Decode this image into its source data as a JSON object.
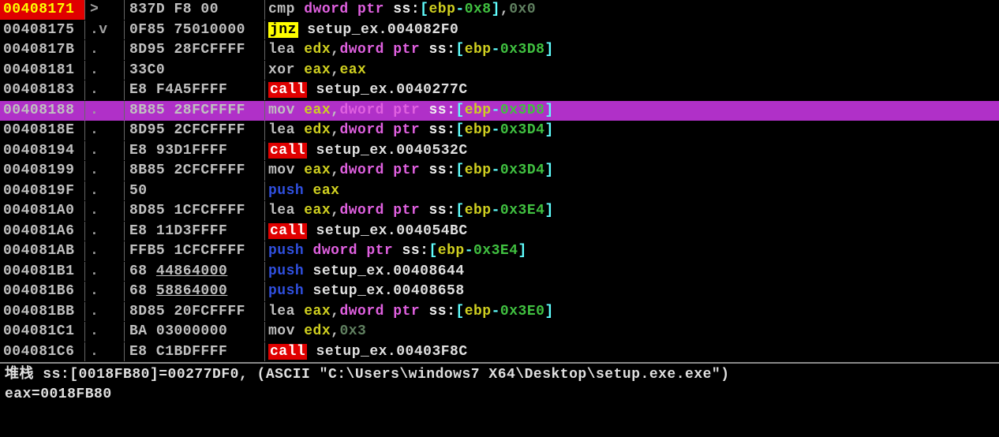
{
  "rows": [
    {
      "addr": "00408171",
      "addr_hl": true,
      "hint": ">",
      "bytes": "837D F8 00",
      "tok": [
        {
          "t": "cmp ",
          "c": "mn"
        },
        {
          "t": "dword ptr ",
          "c": "kw-ptr"
        },
        {
          "t": "ss",
          "c": "seg"
        },
        {
          "t": ":",
          "c": "seg"
        },
        {
          "t": "[",
          "c": "br"
        },
        {
          "t": "ebp",
          "c": "reg-y"
        },
        {
          "t": "-",
          "c": "br"
        },
        {
          "t": "0x8",
          "c": "num"
        },
        {
          "t": "]",
          "c": "br"
        },
        {
          "t": ",",
          "c": "comma"
        },
        {
          "t": "0x0",
          "c": "num-dim"
        }
      ]
    },
    {
      "addr": "00408175",
      "hint": ".v",
      "bytes": "0F85 75010000",
      "tok": [
        {
          "t": "jnz",
          "c": "mn-jmp-bg"
        },
        {
          "t": " setup_ex.004082F0",
          "c": "txt"
        }
      ]
    },
    {
      "addr": "0040817B",
      "hint": ".",
      "bytes": "8D95 28FCFFFF",
      "tok": [
        {
          "t": "lea ",
          "c": "mn"
        },
        {
          "t": "edx",
          "c": "reg-y"
        },
        {
          "t": ",",
          "c": "comma"
        },
        {
          "t": "dword ptr ",
          "c": "kw-ptr"
        },
        {
          "t": "ss",
          "c": "seg"
        },
        {
          "t": ":",
          "c": "seg"
        },
        {
          "t": "[",
          "c": "br"
        },
        {
          "t": "ebp",
          "c": "reg-y"
        },
        {
          "t": "-",
          "c": "br"
        },
        {
          "t": "0x3D8",
          "c": "num"
        },
        {
          "t": "]",
          "c": "br"
        }
      ]
    },
    {
      "addr": "00408181",
      "hint": ".",
      "bytes": "33C0",
      "tok": [
        {
          "t": "xor ",
          "c": "mn"
        },
        {
          "t": "eax",
          "c": "reg-y"
        },
        {
          "t": ",",
          "c": "comma"
        },
        {
          "t": "eax",
          "c": "reg-y"
        }
      ]
    },
    {
      "addr": "00408183",
      "hint": ".",
      "bytes": "E8 F4A5FFFF",
      "tok": [
        {
          "t": "call",
          "c": "mn-call-bg"
        },
        {
          "t": " setup_ex.0040277C",
          "c": "txt"
        }
      ]
    },
    {
      "addr": "00408188",
      "sel": true,
      "hint": ".",
      "bytes": "8B85 28FCFFFF",
      "tok": [
        {
          "t": "mov ",
          "c": "mn"
        },
        {
          "t": "eax",
          "c": "reg-y"
        },
        {
          "t": ",",
          "c": "comma"
        },
        {
          "t": "dword ptr ",
          "c": "kw-ptr"
        },
        {
          "t": "ss",
          "c": "seg"
        },
        {
          "t": ":",
          "c": "seg"
        },
        {
          "t": "[",
          "c": "br"
        },
        {
          "t": "ebp",
          "c": "reg-y"
        },
        {
          "t": "-",
          "c": "br"
        },
        {
          "t": "0x3D8",
          "c": "num"
        },
        {
          "t": "]",
          "c": "br"
        }
      ]
    },
    {
      "addr": "0040818E",
      "hint": ".",
      "bytes": "8D95 2CFCFFFF",
      "tok": [
        {
          "t": "lea ",
          "c": "mn"
        },
        {
          "t": "edx",
          "c": "reg-y"
        },
        {
          "t": ",",
          "c": "comma"
        },
        {
          "t": "dword ptr ",
          "c": "kw-ptr"
        },
        {
          "t": "ss",
          "c": "seg"
        },
        {
          "t": ":",
          "c": "seg"
        },
        {
          "t": "[",
          "c": "br"
        },
        {
          "t": "ebp",
          "c": "reg-y"
        },
        {
          "t": "-",
          "c": "br"
        },
        {
          "t": "0x3D4",
          "c": "num"
        },
        {
          "t": "]",
          "c": "br"
        }
      ]
    },
    {
      "addr": "00408194",
      "hint": ".",
      "bytes": "E8 93D1FFFF",
      "tok": [
        {
          "t": "call",
          "c": "mn-call-bg"
        },
        {
          "t": " setup_ex.0040532C",
          "c": "txt"
        }
      ]
    },
    {
      "addr": "00408199",
      "hint": ".",
      "bytes": "8B85 2CFCFFFF",
      "tok": [
        {
          "t": "mov ",
          "c": "mn"
        },
        {
          "t": "eax",
          "c": "reg-y"
        },
        {
          "t": ",",
          "c": "comma"
        },
        {
          "t": "dword ptr ",
          "c": "kw-ptr"
        },
        {
          "t": "ss",
          "c": "seg"
        },
        {
          "t": ":",
          "c": "seg"
        },
        {
          "t": "[",
          "c": "br"
        },
        {
          "t": "ebp",
          "c": "reg-y"
        },
        {
          "t": "-",
          "c": "br"
        },
        {
          "t": "0x3D4",
          "c": "num"
        },
        {
          "t": "]",
          "c": "br"
        }
      ]
    },
    {
      "addr": "0040819F",
      "hint": ".",
      "bytes": "50",
      "tok": [
        {
          "t": "push ",
          "c": "mn-push-dim"
        },
        {
          "t": "eax",
          "c": "reg-y"
        }
      ]
    },
    {
      "addr": "004081A0",
      "hint": ".",
      "bytes": "8D85 1CFCFFFF",
      "tok": [
        {
          "t": "lea ",
          "c": "mn"
        },
        {
          "t": "eax",
          "c": "reg-y"
        },
        {
          "t": ",",
          "c": "comma"
        },
        {
          "t": "dword ptr ",
          "c": "kw-ptr"
        },
        {
          "t": "ss",
          "c": "seg"
        },
        {
          "t": ":",
          "c": "seg"
        },
        {
          "t": "[",
          "c": "br"
        },
        {
          "t": "ebp",
          "c": "reg-y"
        },
        {
          "t": "-",
          "c": "br"
        },
        {
          "t": "0x3E4",
          "c": "num"
        },
        {
          "t": "]",
          "c": "br"
        }
      ]
    },
    {
      "addr": "004081A6",
      "hint": ".",
      "bytes": "E8 11D3FFFF",
      "tok": [
        {
          "t": "call",
          "c": "mn-call-bg"
        },
        {
          "t": " setup_ex.004054BC",
          "c": "txt"
        }
      ]
    },
    {
      "addr": "004081AB",
      "hint": ".",
      "bytes": "FFB5 1CFCFFFF",
      "tok": [
        {
          "t": "push ",
          "c": "mn-push-dim"
        },
        {
          "t": "dword ptr ",
          "c": "kw-ptr"
        },
        {
          "t": "ss",
          "c": "seg"
        },
        {
          "t": ":",
          "c": "seg"
        },
        {
          "t": "[",
          "c": "br"
        },
        {
          "t": "ebp",
          "c": "reg-y"
        },
        {
          "t": "-",
          "c": "br"
        },
        {
          "t": "0x3E4",
          "c": "num"
        },
        {
          "t": "]",
          "c": "br"
        }
      ]
    },
    {
      "addr": "004081B1",
      "hint": ".",
      "bytes": "68 ",
      "bytes2": "44864000",
      "tok": [
        {
          "t": "push ",
          "c": "mn-push-dim"
        },
        {
          "t": "setup_ex.00408644",
          "c": "txt"
        }
      ]
    },
    {
      "addr": "004081B6",
      "hint": ".",
      "bytes": "68 ",
      "bytes2": "58864000",
      "tok": [
        {
          "t": "push ",
          "c": "mn-push-dim"
        },
        {
          "t": "setup_ex.00408658",
          "c": "txt"
        }
      ]
    },
    {
      "addr": "004081BB",
      "hint": ".",
      "bytes": "8D85 20FCFFFF",
      "tok": [
        {
          "t": "lea ",
          "c": "mn"
        },
        {
          "t": "eax",
          "c": "reg-y"
        },
        {
          "t": ",",
          "c": "comma"
        },
        {
          "t": "dword ptr ",
          "c": "kw-ptr"
        },
        {
          "t": "ss",
          "c": "seg"
        },
        {
          "t": ":",
          "c": "seg"
        },
        {
          "t": "[",
          "c": "br"
        },
        {
          "t": "ebp",
          "c": "reg-y"
        },
        {
          "t": "-",
          "c": "br"
        },
        {
          "t": "0x3E0",
          "c": "num"
        },
        {
          "t": "]",
          "c": "br"
        }
      ]
    },
    {
      "addr": "004081C1",
      "hint": ".",
      "bytes": "BA 03000000",
      "tok": [
        {
          "t": "mov ",
          "c": "mn"
        },
        {
          "t": "edx",
          "c": "reg-y"
        },
        {
          "t": ",",
          "c": "comma"
        },
        {
          "t": "0x3",
          "c": "num-dim"
        }
      ]
    },
    {
      "addr": "004081C6",
      "hint": ".",
      "bytes": "E8 C1BDFFFF",
      "tok": [
        {
          "t": "call",
          "c": "mn-call-bg"
        },
        {
          "t": " setup_ex.00403F8C",
          "c": "txt"
        }
      ]
    }
  ],
  "info": {
    "line1": "堆栈 ss:[0018FB80]=00277DF0, (ASCII \"C:\\Users\\windows7 X64\\Desktop\\setup.exe.exe\")",
    "line2": "eax=0018FB80"
  }
}
